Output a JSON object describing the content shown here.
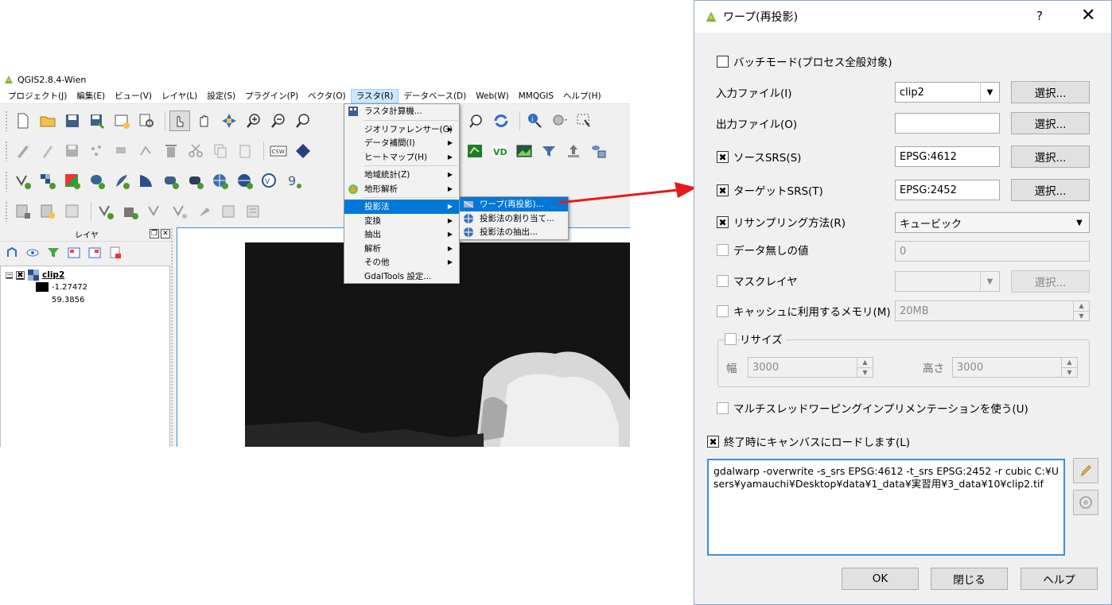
{
  "qgis": {
    "title": "QGIS2.8.4-Wien",
    "menus": [
      "プロジェクト(J)",
      "編集(E)",
      "ビュー(V)",
      "レイヤ(L)",
      "設定(S)",
      "プラグイン(P)",
      "ベクタ(O)",
      "ラスタ(R)",
      "データベース(D)",
      "Web(W)",
      "MMQGIS",
      "ヘルプ(H)"
    ],
    "active_menu": "ラスタ(R)"
  },
  "layers_panel": {
    "title": "レイヤ",
    "layer_name": "clip2",
    "min": "-1.27472",
    "max": "59.3856"
  },
  "raster_menu": {
    "items": [
      "ラスタ計算機...",
      "ジオリファレンサー(G)",
      "データ補間(I)",
      "ヒートマップ(H)",
      "地域統計(Z)",
      "地形解析",
      "投影法",
      "変換",
      "抽出",
      "解析",
      "その他",
      "GdalTools 設定..."
    ]
  },
  "projection_submenu": {
    "items": [
      "ワープ(再投影)...",
      "投影法の割り当て...",
      "投影法の抽出..."
    ]
  },
  "dialog": {
    "title": "ワープ(再投影)",
    "help_glyph": "?",
    "close_glyph": "✕",
    "batch_mode": "バッチモード(プロセス全般対象)",
    "input_file_label": "入力ファイル(I)",
    "input_file_value": "clip2",
    "output_file_label": "出力ファイル(O)",
    "output_file_value": "",
    "select_label": "選択...",
    "source_srs_label": "ソースSRS(S)",
    "source_srs_value": "EPSG:4612",
    "target_srs_label": "ターゲットSRS(T)",
    "target_srs_value": "EPSG:2452",
    "resampling_label": "リサンプリング方法(R)",
    "resampling_value": "キュービック",
    "nodata_label": "データ無しの値",
    "nodata_value": "0",
    "mask_layer_label": "マスクレイヤ",
    "cache_label": "キャッシュに利用するメモリ(M)",
    "cache_value": "20MB",
    "resize_label": "リサイズ",
    "width_label": "幅",
    "width_value": "3000",
    "height_label": "高さ",
    "height_value": "3000",
    "multithread_label": "マルチスレッドワーピングインプリメンテーションを使う(U)",
    "load_canvas_label": "終了時にキャンバスにロードします(L)",
    "command": "gdalwarp -overwrite -s_srs EPSG:4612 -t_srs EPSG:2452 -r cubic C:¥Users¥yamauchi¥Desktop¥data¥1_data¥実習用¥3_data¥10¥clip2.tif",
    "ok_label": "OK",
    "close_label": "閉じる",
    "help_label": "ヘルプ"
  },
  "colors": {
    "highlight": "#0078d7",
    "arrow": "#e8191c",
    "focus_border": "#3c8fd8"
  }
}
